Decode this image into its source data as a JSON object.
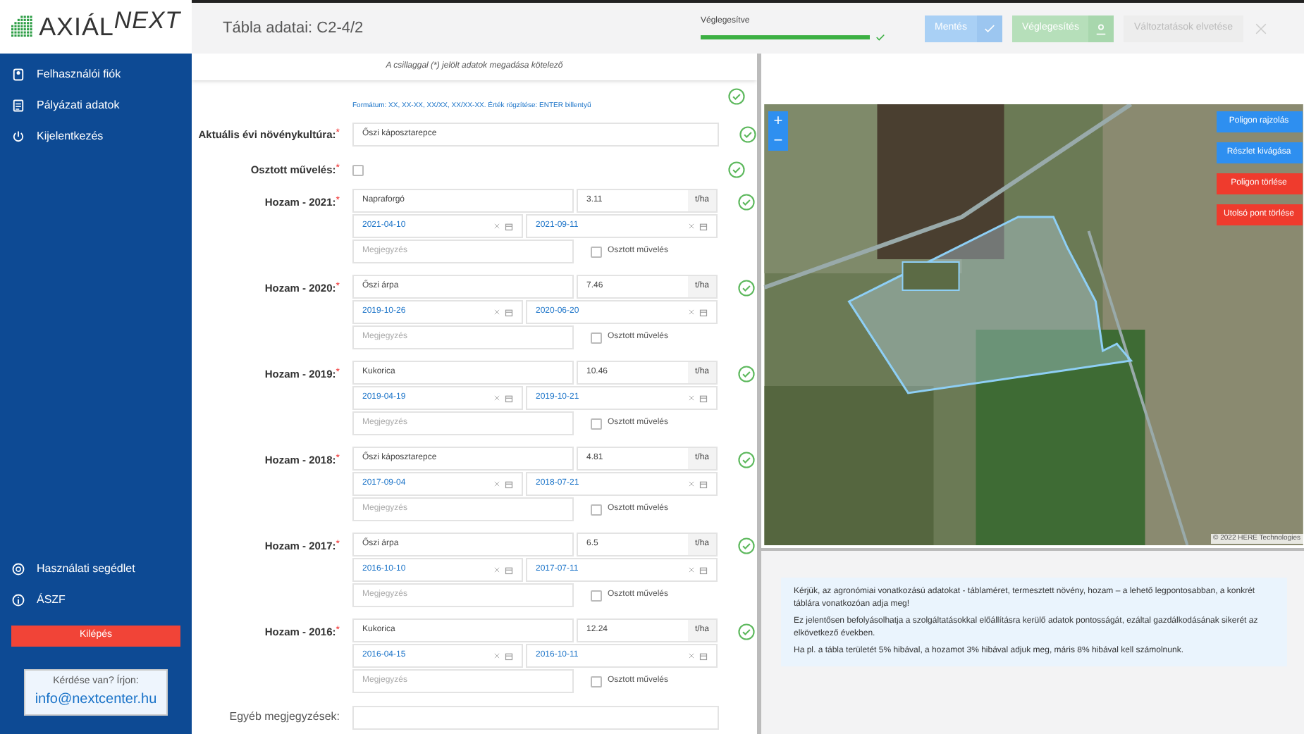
{
  "logo": {
    "text": "AXIÁL",
    "accent": "NEXT"
  },
  "sidebar": {
    "items": [
      {
        "label": "Felhasználói fiók"
      },
      {
        "label": "Pályázati adatok"
      },
      {
        "label": "Kijelentkezés"
      }
    ],
    "bottom_items": [
      {
        "label": "Használati segédlet"
      },
      {
        "label": "ÁSZF"
      }
    ],
    "logout_button": "Kilépés",
    "contact": {
      "question": "Kérdése van? Írjon:",
      "email": "info@nextcenter.hu"
    }
  },
  "header": {
    "title": "Tábla adatai: C2-4/2",
    "progress": {
      "label": "Véglegesítve",
      "level": 1
    },
    "buttons": [
      {
        "label": "Mentés",
        "kind": "save"
      },
      {
        "label": "Véglegesítés",
        "kind": "finalize"
      },
      {
        "label": "Változtatások elvetése",
        "kind": "discard"
      }
    ]
  },
  "form": {
    "notice": "A csillaggal (*) jelölt adatok megadása kötelező",
    "hint": "Formátum: XX, XX-XX, XX/XX, XX/XX-XX. Érték rögzítése: ENTER billentyű",
    "current_crop": {
      "label": "Aktuális évi növénykultúra:",
      "mark": "*",
      "value": "Őszi káposztarepce"
    },
    "split": {
      "label": "Osztott művelés:",
      "mark": "*",
      "checked": false
    },
    "yields": [
      {
        "label": "Hozam - 2021:",
        "mark": "*",
        "crop": "Napraforgó",
        "amount": "3.11",
        "unit": "t/ha",
        "start": "2021-04-10",
        "end": "2021-09-11",
        "note_placeholder": "Megjegyzés",
        "split_label": "Osztott művelés",
        "split": false
      },
      {
        "label": "Hozam - 2020:",
        "mark": "*",
        "crop": "Őszi árpa",
        "amount": "7.46",
        "unit": "t/ha",
        "start": "2019-10-26",
        "end": "2020-06-20",
        "note_placeholder": "Megjegyzés",
        "split_label": "Osztott művelés",
        "split": false
      },
      {
        "label": "Hozam - 2019:",
        "mark": "*",
        "crop": "Kukorica",
        "amount": "10.46",
        "unit": "t/ha",
        "start": "2019-04-19",
        "end": "2019-10-21",
        "note_placeholder": "Megjegyzés",
        "split_label": "Osztott művelés",
        "split": false
      },
      {
        "label": "Hozam - 2018:",
        "mark": "*",
        "crop": "Őszi káposztarepce",
        "amount": "4.81",
        "unit": "t/ha",
        "start": "2017-09-04",
        "end": "2018-07-21",
        "note_placeholder": "Megjegyzés",
        "split_label": "Osztott művelés",
        "split": false
      },
      {
        "label": "Hozam - 2017:",
        "mark": "*",
        "crop": "Őszi árpa",
        "amount": "6.5",
        "unit": "t/ha",
        "start": "2016-10-10",
        "end": "2017-07-11",
        "note_placeholder": "Megjegyzés",
        "split_label": "Osztott művelés",
        "split": false
      },
      {
        "label": "Hozam - 2016:",
        "mark": "*",
        "crop": "Kukorica",
        "amount": "12.24",
        "unit": "t/ha",
        "start": "2016-04-15",
        "end": "2016-10-11",
        "note_placeholder": "Megjegyzés",
        "split_label": "Osztott művelés",
        "split": false
      }
    ],
    "other_notes": {
      "label": "Egyéb megjegyzések:"
    }
  },
  "map": {
    "zoom_in": "+",
    "zoom_out": "−",
    "tools": [
      {
        "label": "Poligon rajzolás",
        "kind": "primary"
      },
      {
        "label": "Részlet kivágása",
        "kind": "primary"
      },
      {
        "label": "Poligon törlése",
        "kind": "danger"
      },
      {
        "label": "Utolsó pont törlése",
        "kind": "danger"
      }
    ],
    "attribution": "© 2022 HERE Technologies"
  },
  "info": [
    "Kérjük, az agronómiai vonatkozású adatokat - táblaméret, termesztett növény, hozam – a lehető legpontosabban, a konkrét táblára vonatkozóan adja meg!",
    "Ez jelentősen befolyásolhatja a szolgáltatásokkal előállításra kerülő adatok pontosságát, ezáltal gazdálkodásának sikerét az elkövetkező években.",
    "Ha pl. a tábla területét 5% hibával, a hozamot 3% hibával adjuk meg, máris 8% hibával kell számolnunk."
  ]
}
